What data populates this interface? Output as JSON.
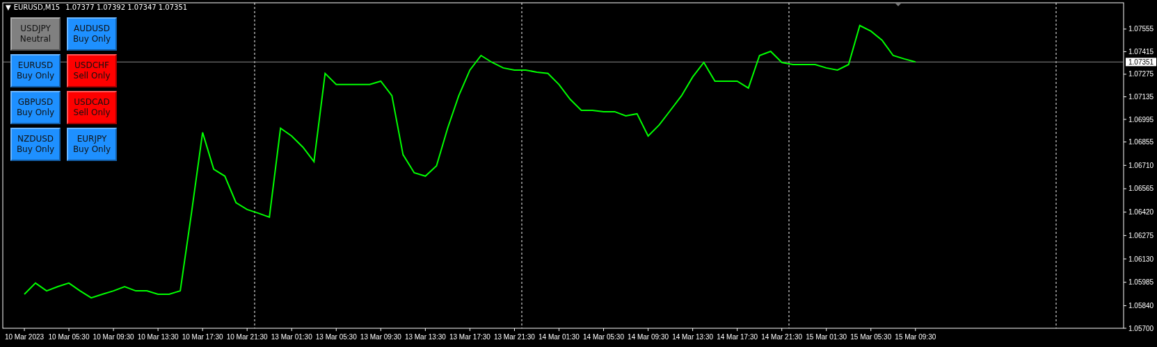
{
  "chart": {
    "title_glyph": "▼",
    "quote": "1.07377 1.07392 1.07347 1.07351",
    "buttons": [
      {
        "symbol": "USDJPY",
        "mode": "Neutral",
        "color": "#808080"
      },
      {
        "symbol": "AUDUSD",
        "mode": "Buy Only",
        "color": "#1e90ff"
      },
      {
        "symbol": "EURUSD",
        "mode": "Buy Only",
        "color": "#1e90ff"
      },
      {
        "symbol": "USDCHF",
        "mode": "Sell Only",
        "color": "#ff0000"
      },
      {
        "symbol": "GBPUSD",
        "mode": "Buy Only",
        "color": "#1e90ff"
      },
      {
        "symbol": "USDCAD",
        "mode": "Sell Only",
        "color": "#ff0000"
      },
      {
        "symbol": "NZDUSD",
        "mode": "Buy Only",
        "color": "#1e90ff"
      },
      {
        "symbol": "EURJPY",
        "mode": "Buy Only",
        "color": "#1e90ff"
      }
    ],
    "chart_data": {
      "type": "line",
      "ylim": [
        1.057,
        1.07718
      ],
      "categories": [
        "10 Mar 2023",
        null,
        null,
        null,
        "10 Mar 05:30",
        null,
        null,
        null,
        "10 Mar 09:30",
        null,
        null,
        null,
        "10 Mar 13:30",
        null,
        null,
        null,
        "10 Mar 17:30",
        null,
        null,
        null,
        "10 Mar 21:30",
        null,
        null,
        null,
        "13 Mar 01:30",
        null,
        null,
        null,
        "13 Mar 05:30",
        null,
        null,
        null,
        "13 Mar 09:30",
        null,
        null,
        null,
        "13 Mar 13:30",
        null,
        null,
        null,
        "13 Mar 17:30",
        null,
        null,
        null,
        "13 Mar 21:30",
        null,
        null,
        null,
        "14 Mar 01:30",
        null,
        null,
        null,
        "14 Mar 05:30",
        null,
        null,
        null,
        "14 Mar 09:30",
        null,
        null,
        null,
        "14 Mar 13:30",
        null,
        null,
        null,
        "14 Mar 17:30",
        null,
        null,
        null,
        "14 Mar 21:30",
        null,
        null,
        null,
        "15 Mar 01:30",
        null,
        null,
        null,
        "15 Mar 05:30",
        null,
        null,
        null,
        "15 Mar 09:30"
      ],
      "ref_lines": [
        {
          "axis": "y",
          "value": 1.07351,
          "label": "1.07351",
          "color": "#8a8a8a"
        }
      ],
      "series": [
        {
          "name": "EURUSD,M15",
          "color": "#00ff00",
          "values": [
            1.05911,
            1.0598,
            1.05932,
            1.05958,
            1.0598,
            1.05932,
            1.05889,
            1.05911,
            1.05932,
            1.05958,
            1.05932,
            1.05932,
            1.05911,
            1.05911,
            1.05932,
            1.06414,
            1.06914,
            1.06686,
            1.06643,
            1.06479,
            1.06436,
            1.06414,
            1.06389,
            1.0694,
            1.06892,
            1.06823,
            1.06733,
            1.0728,
            1.07211,
            1.07211,
            1.07211,
            1.07211,
            1.07232,
            1.07142,
            1.06776,
            1.06664,
            1.06643,
            1.06707,
            1.0694,
            1.07142,
            1.07301,
            1.07391,
            1.07348,
            1.07314,
            1.07301,
            1.07301,
            1.07288,
            1.0728,
            1.07211,
            1.0712,
            1.07051,
            1.07051,
            1.07043,
            1.07043,
            1.07017,
            1.0703,
            1.06892,
            1.06961,
            1.07051,
            1.07142,
            1.07258,
            1.07348,
            1.07232,
            1.07232,
            1.07232,
            1.07189,
            1.07391,
            1.07417,
            1.07348,
            1.07335,
            1.07335,
            1.07335,
            1.07314,
            1.07301,
            1.07335,
            1.07577,
            1.07542,
            1.07486,
            1.07391,
            1.0737,
            1.07351
          ]
        }
      ],
      "yticks": [
        {
          "value": 1.07555,
          "label": "1.07555"
        },
        {
          "value": 1.07415,
          "label": "1.07415"
        },
        {
          "value": 1.07275,
          "label": "1.07275"
        },
        {
          "value": 1.07135,
          "label": "1.07135"
        },
        {
          "value": 1.06995,
          "label": "1.06995"
        },
        {
          "value": 1.06855,
          "label": "1.06855"
        },
        {
          "value": 1.0671,
          "label": "1.06710"
        },
        {
          "value": 1.06565,
          "label": "1.06565"
        },
        {
          "value": 1.0642,
          "label": "1.06420"
        },
        {
          "value": 1.06275,
          "label": "1.06275"
        },
        {
          "value": 1.0613,
          "label": "1.06130"
        },
        {
          "value": 1.05985,
          "label": "1.05985"
        },
        {
          "value": 1.0584,
          "label": "1.05840"
        },
        {
          "value": 1.057,
          "label": "1.05700"
        }
      ]
    }
  }
}
